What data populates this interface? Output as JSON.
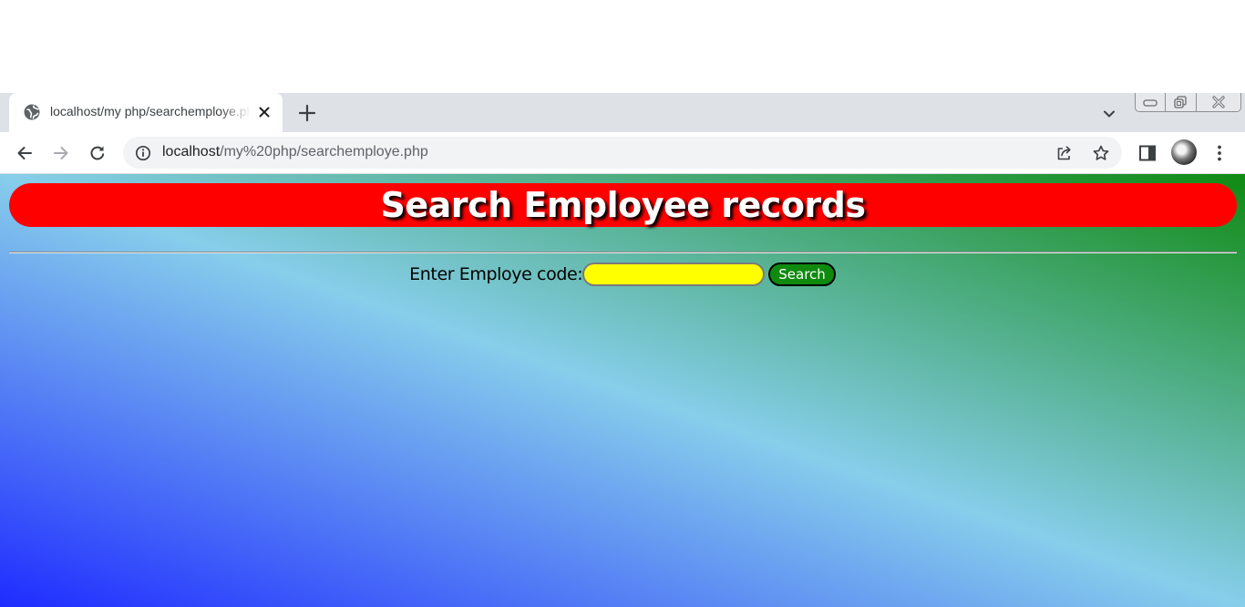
{
  "browser": {
    "tab": {
      "title": "localhost/my php/searchemploye.php",
      "favicon_icon": "globe-icon",
      "close_icon": "close-icon"
    },
    "new_tab_icon": "plus-icon",
    "tab_search_icon": "chevron-down-icon",
    "window_controls": [
      "minimize-icon",
      "restore-icon",
      "close-icon"
    ],
    "toolbar": {
      "back_icon": "back-arrow-icon",
      "forward_icon": "forward-arrow-icon",
      "reload_icon": "reload-icon",
      "site_info_icon": "info-icon",
      "url_host": "localhost",
      "url_path": "/my%20php/searchemploye.php",
      "share_icon": "share-icon",
      "bookmark_icon": "star-icon",
      "side_panel_icon": "side-panel-icon",
      "menu_icon": "kebab-menu-icon"
    }
  },
  "page": {
    "heading": "Search Employee records",
    "form": {
      "label": "Enter Employe code:",
      "input_value": "",
      "button_label": "Search"
    }
  },
  "colors": {
    "heading_bg": "#ff0000",
    "heading_text": "#ffffff",
    "input_bg": "#ffff00",
    "button_bg": "#0f8a0f",
    "gradient_start": "#1f2cff",
    "gradient_mid": "#87ceeb",
    "gradient_end": "#108a12"
  }
}
